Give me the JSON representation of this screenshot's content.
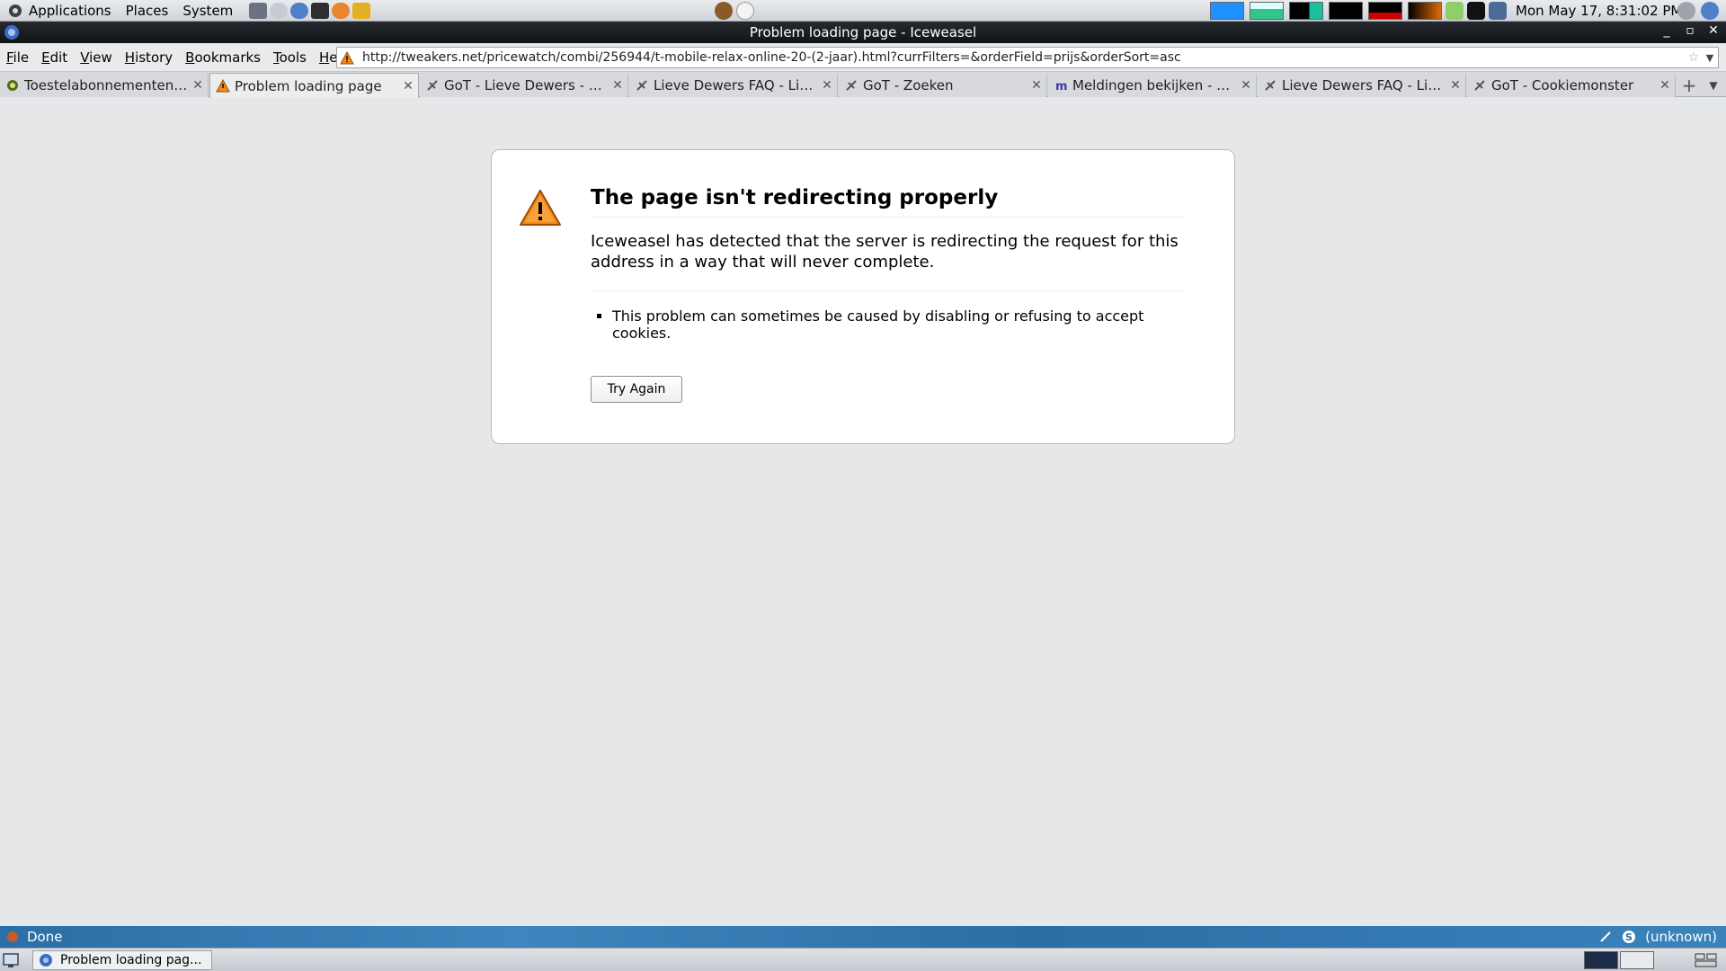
{
  "panel": {
    "menus": [
      "Applications",
      "Places",
      "System"
    ],
    "clock": "Mon May 17,  8:31:02 PM"
  },
  "window": {
    "title": "Problem loading page - Iceweasel"
  },
  "menubar": {
    "items": [
      "File",
      "Edit",
      "View",
      "History",
      "Bookmarks",
      "Tools",
      "Help"
    ]
  },
  "urlbar": {
    "value": "http://tweakers.net/pricewatch/combi/256944/t-mobile-relax-online-20-(2-jaar).html?currFilters=&orderField=prijs&orderSort=asc"
  },
  "tabs": [
    {
      "label": "Toestelabonnementen ...",
      "icon": "tweakers-icon",
      "active": false
    },
    {
      "label": "Problem loading page",
      "icon": "warning-icon",
      "active": true
    },
    {
      "label": "GoT - Lieve Dewers - T...",
      "icon": "got-icon",
      "active": false
    },
    {
      "label": "Lieve Dewers FAQ - Lie...",
      "icon": "got-icon",
      "active": false
    },
    {
      "label": "GoT - Zoeken",
      "icon": "got-icon",
      "active": false
    },
    {
      "label": "Meldingen bekijken - M...",
      "icon": "m-icon",
      "active": false
    },
    {
      "label": "Lieve Dewers FAQ - Lie...",
      "icon": "got-icon",
      "active": false
    },
    {
      "label": "GoT - Cookiemonster",
      "icon": "got-icon",
      "active": false
    }
  ],
  "error": {
    "title": "The page isn't redirecting properly",
    "description": "Iceweasel has detected that the server is redirecting the request for this address in a way that will never complete.",
    "bullets": [
      "This problem can sometimes be caused by disabling or refusing to accept cookies."
    ],
    "button": "Try Again"
  },
  "statusbar": {
    "text": "Done",
    "right": "(unknown)"
  },
  "taskbar": {
    "item": "Problem loading pag..."
  },
  "colors": {
    "warning": "#f08a1c",
    "statusbar": "#2f74ad",
    "titlebar": "#1a1d21"
  }
}
